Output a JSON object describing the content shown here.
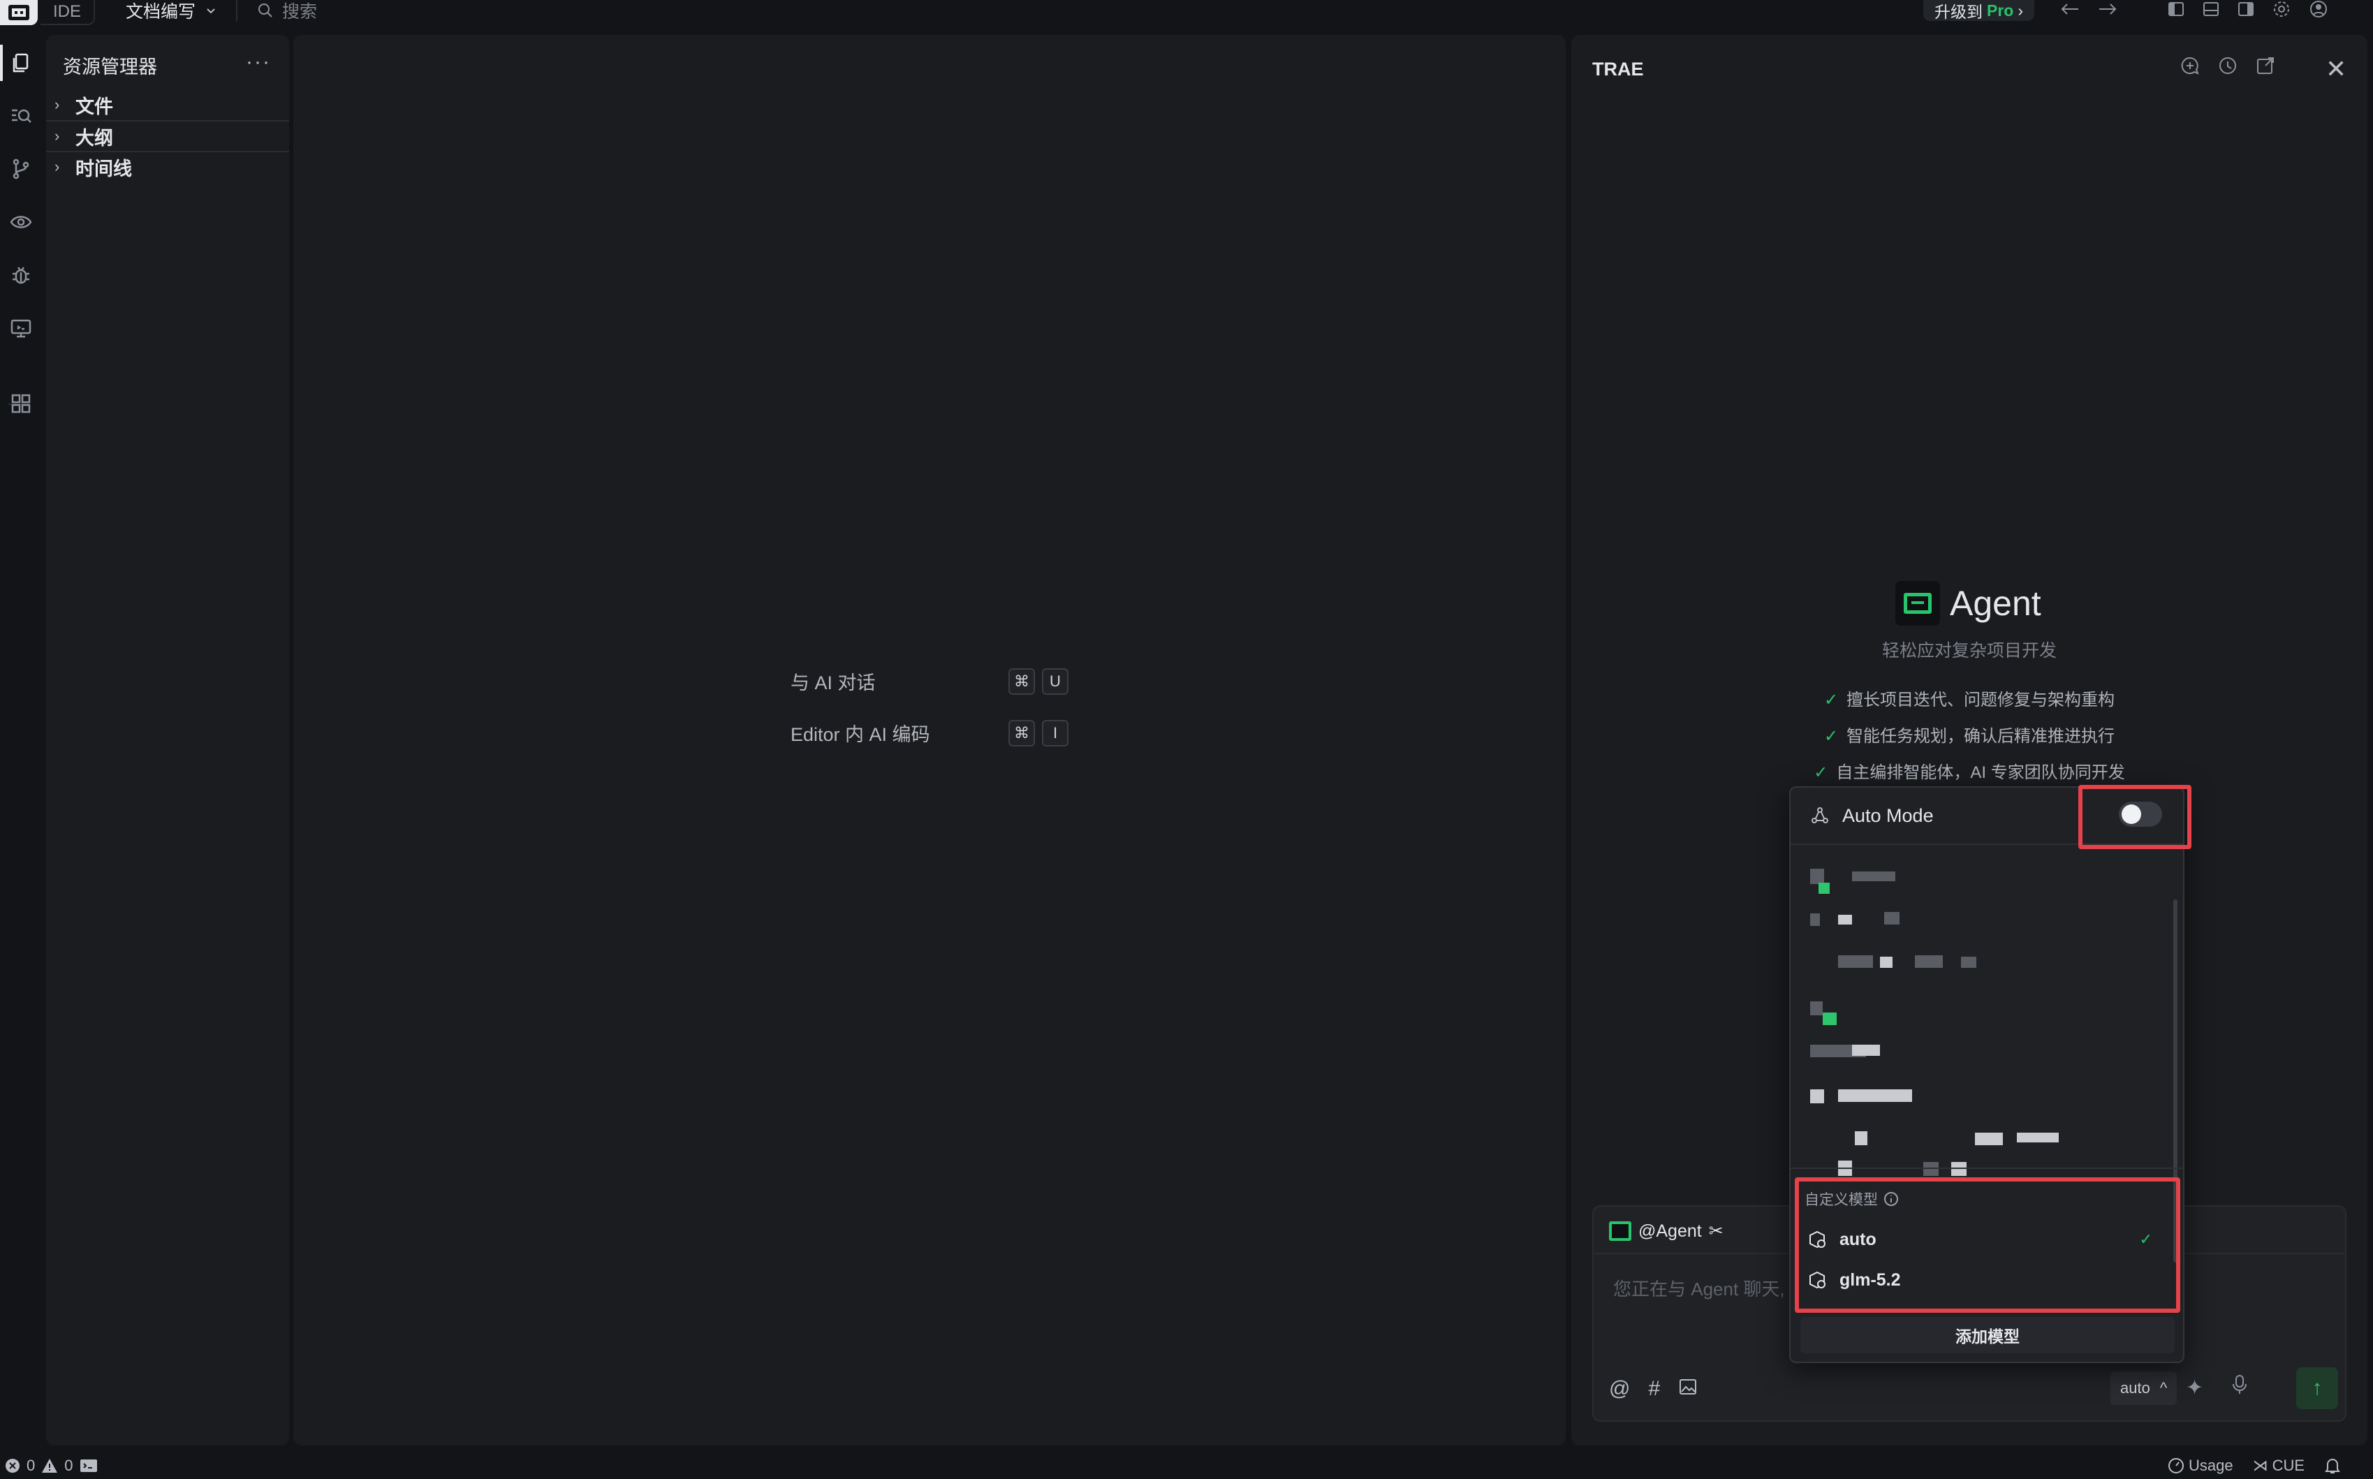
{
  "titlebar": {
    "ide_label": "IDE",
    "mode_label": "文档编写",
    "search_placeholder": "搜索",
    "upgrade_prefix": "升级到",
    "upgrade_pro": "Pro"
  },
  "explorer": {
    "title": "资源管理器",
    "more": "···",
    "sections": [
      {
        "label": "文件"
      },
      {
        "label": "大纲"
      },
      {
        "label": "时间线"
      }
    ]
  },
  "editor": {
    "hints": [
      {
        "label": "与 AI 对话",
        "keys": [
          "⌘",
          "U"
        ]
      },
      {
        "label": "Editor 内 AI 编码",
        "keys": [
          "⌘",
          "I"
        ]
      }
    ]
  },
  "panel": {
    "title": "TRAE",
    "agent_name": "Agent",
    "agent_subtitle": "轻松应对复杂项目开发",
    "features": [
      "擅长项目迭代、问题修复与架构重构",
      "智能任务规划，确认后精准推进执行",
      "自主编排智能体，AI 专家团队协同开发"
    ],
    "chat": {
      "tag": "@Agent",
      "placeholder": "您正在与 Agent 聊天,",
      "model": "auto"
    }
  },
  "model_dropdown": {
    "auto_mode_label": "Auto Mode",
    "auto_mode_enabled": false,
    "custom_section_label": "自定义模型",
    "custom_models": [
      {
        "name": "auto",
        "selected": true
      },
      {
        "name": "glm-5.2",
        "selected": false
      }
    ],
    "add_model_label": "添加模型"
  },
  "statusbar": {
    "errors": "0",
    "warnings": "0",
    "usage_label": "Usage",
    "cue_label": "CUE"
  },
  "colors": {
    "accent_green": "#27c46b",
    "highlight_red": "#e5424a"
  }
}
